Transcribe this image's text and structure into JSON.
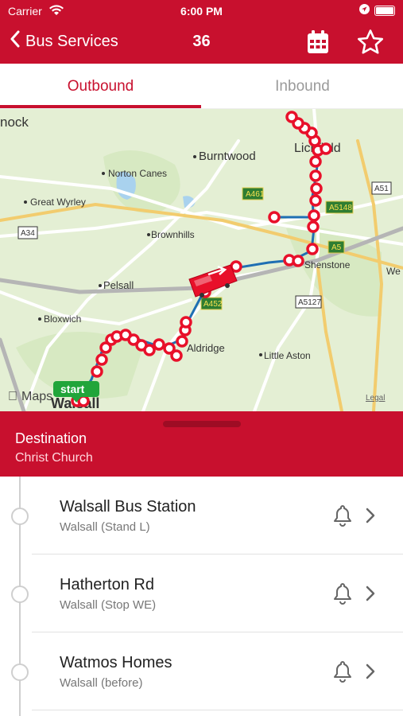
{
  "status_bar": {
    "carrier": "Carrier",
    "time": "6:00 PM"
  },
  "nav": {
    "back_label": "Bus Services",
    "route_number": "36"
  },
  "tabs": [
    {
      "label": "Outbound",
      "active": true
    },
    {
      "label": "Inbound",
      "active": false
    }
  ],
  "map": {
    "places": [
      "nock",
      "Burntwood",
      "Lichfield",
      "Norton Canes",
      "Great Wyrley",
      "Brownhills",
      "Pelsall",
      "Shenstone",
      "Bloxwich",
      "Aldridge",
      "Little Aston",
      "Walsall",
      "We"
    ],
    "roads": [
      "A461",
      "A5148",
      "A51",
      "A34",
      "A5",
      "A452",
      "A5127"
    ],
    "start_label": "start",
    "attribution": "Maps",
    "legal": "Legal"
  },
  "destination": {
    "label": "Destination",
    "value": "Christ Church"
  },
  "stops": [
    {
      "name": "Walsall Bus Station",
      "detail": "Walsall (Stand L)"
    },
    {
      "name": "Hatherton Rd",
      "detail": "Walsall (Stop WE)"
    },
    {
      "name": "Watmos Homes",
      "detail": "Walsall (before)"
    }
  ],
  "colors": {
    "brand": "#c8102e",
    "route": "#1f6fb3",
    "map_bg": "#e4efd4"
  }
}
